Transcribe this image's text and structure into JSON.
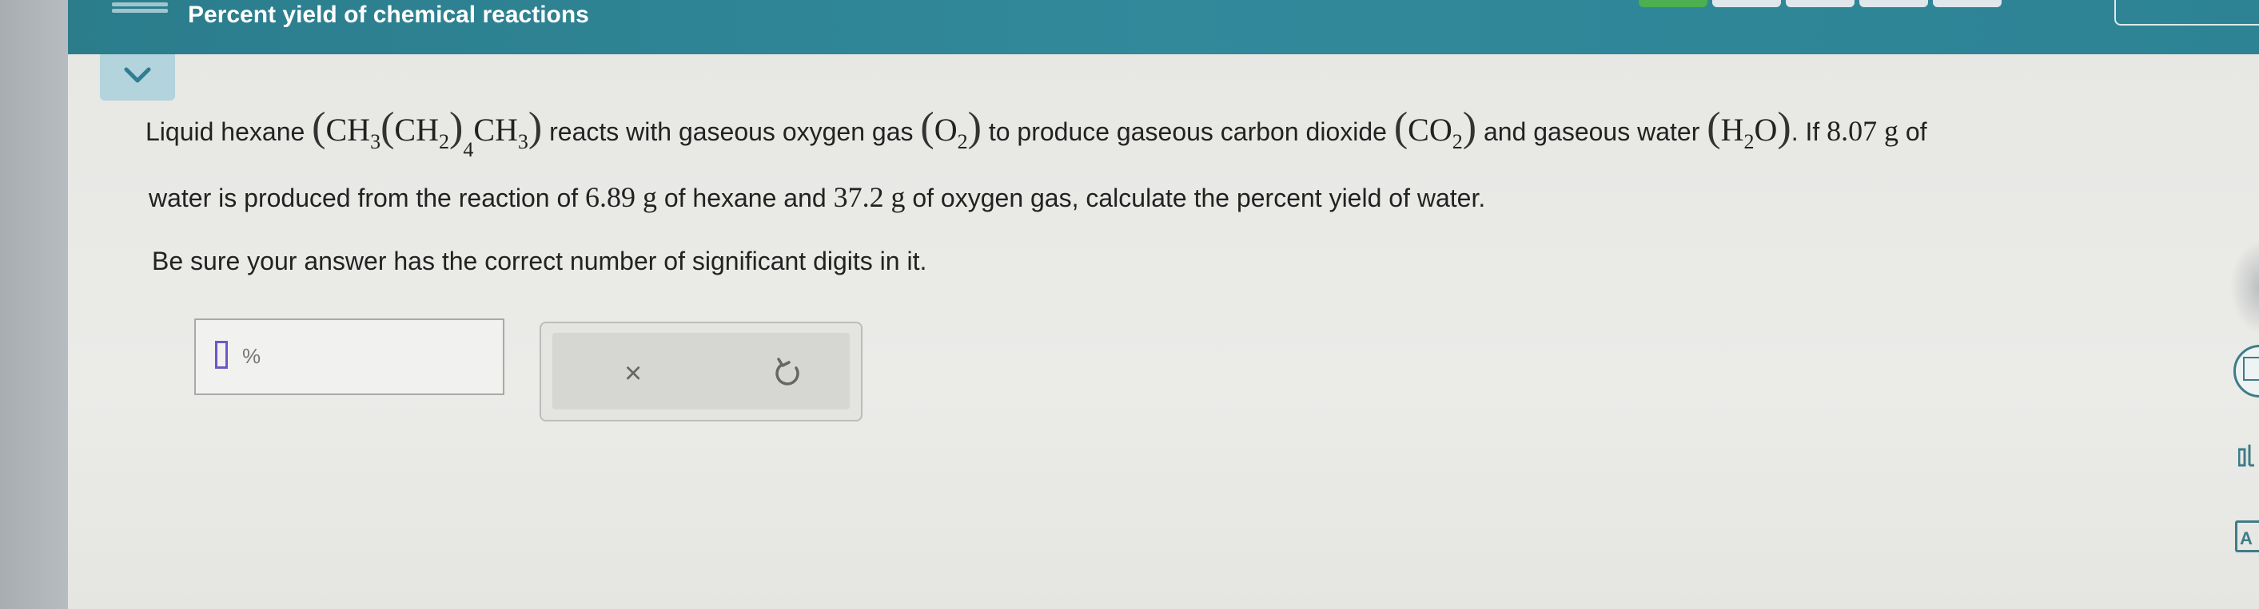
{
  "header": {
    "title": "Percent yield of chemical reactions",
    "menu_icon": "hamburger-icon",
    "colors": {
      "bar": "#2b7d8c",
      "progress_done": "#4caf50"
    }
  },
  "collapse": {
    "icon": "chevron-down-icon"
  },
  "question": {
    "t1": "Liquid hexane",
    "ch": "CH",
    "s3": "3",
    "s2": "2",
    "s4": "4",
    "t2": "reacts with gaseous oxygen gas",
    "o": "O",
    "t3": "to produce gaseous carbon dioxide",
    "co": "CO",
    "t4": "and gaseous water",
    "h": "H",
    "o2": "O",
    "t5": ". If",
    "v1": "8.07",
    "u1": "g",
    "t6": "of",
    "line2_a": "water is produced from the reaction of",
    "v2": "6.89",
    "u2": "g",
    "line2_b": "of hexane and",
    "v3": "37.2",
    "u3": "g",
    "line2_c": "of oxygen gas, calculate the percent yield of water.",
    "note": "Be sure your answer has the correct number of significant digits in it."
  },
  "answer": {
    "value": "",
    "unit": "%"
  },
  "buttons": {
    "clear_label": "×",
    "undo_icon": "undo-icon"
  },
  "tools": {
    "a_label": "A"
  }
}
